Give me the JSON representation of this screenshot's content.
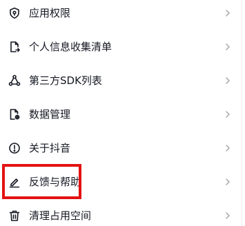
{
  "settings_menu": {
    "items": [
      {
        "label": "应用权限",
        "icon": "shield-lock-icon"
      },
      {
        "label": "个人信息收集清单",
        "icon": "document-export-icon"
      },
      {
        "label": "第三方SDK列表",
        "icon": "triangle-nodes-icon"
      },
      {
        "label": "数据管理",
        "icon": "document-gear-icon"
      },
      {
        "label": "关于抖音",
        "icon": "info-circle-icon"
      },
      {
        "label": "反馈与帮助",
        "icon": "pencil-icon"
      },
      {
        "label": "清理占用空间",
        "icon": "trash-icon"
      }
    ],
    "chevron_icon": "chevron-right-icon"
  },
  "highlight": {
    "target": "反馈与帮助",
    "color": "#e31212"
  },
  "colors": {
    "text": "#161823",
    "icon": "#161823",
    "chevron": "#a5a6ab",
    "background": "#ffffff"
  }
}
